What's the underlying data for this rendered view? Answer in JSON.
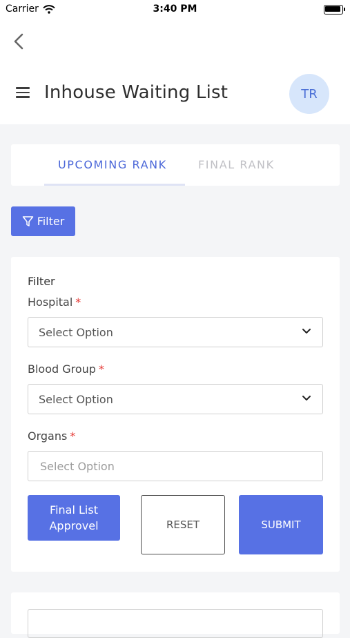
{
  "status_bar": {
    "carrier": "Carrier",
    "time": "3:40 PM"
  },
  "header": {
    "title": "Inhouse Waiting List",
    "avatar_initials": "TR"
  },
  "tabs": [
    {
      "label": "UPCOMING RANK",
      "active": true
    },
    {
      "label": "FINAL RANK",
      "active": false
    }
  ],
  "filter_button": {
    "label": "Filter"
  },
  "filter_card": {
    "title": "Filter",
    "fields": [
      {
        "label": "Hospital",
        "required_mark": "*",
        "value": "Select Option",
        "has_dropdown": true
      },
      {
        "label": "Blood Group",
        "required_mark": "*",
        "value": "Select Option",
        "has_dropdown": true
      },
      {
        "label": "Organs",
        "required_mark": "*",
        "placeholder": "Select Option",
        "has_dropdown": false
      }
    ],
    "buttons": {
      "approve": "Final List Approvel",
      "reset": "RESET",
      "submit": "SUBMIT"
    }
  },
  "colors": {
    "accent": "#5771e4",
    "tab_active": "#4a66d8",
    "tab_inactive": "#c0c0c5",
    "avatar_bg": "#d7e6fb",
    "required": "#e53935"
  },
  "icons": [
    "wifi-icon",
    "battery-icon",
    "back-arrow-icon",
    "hamburger-menu-icon",
    "funnel-icon",
    "chevron-down-icon"
  ]
}
